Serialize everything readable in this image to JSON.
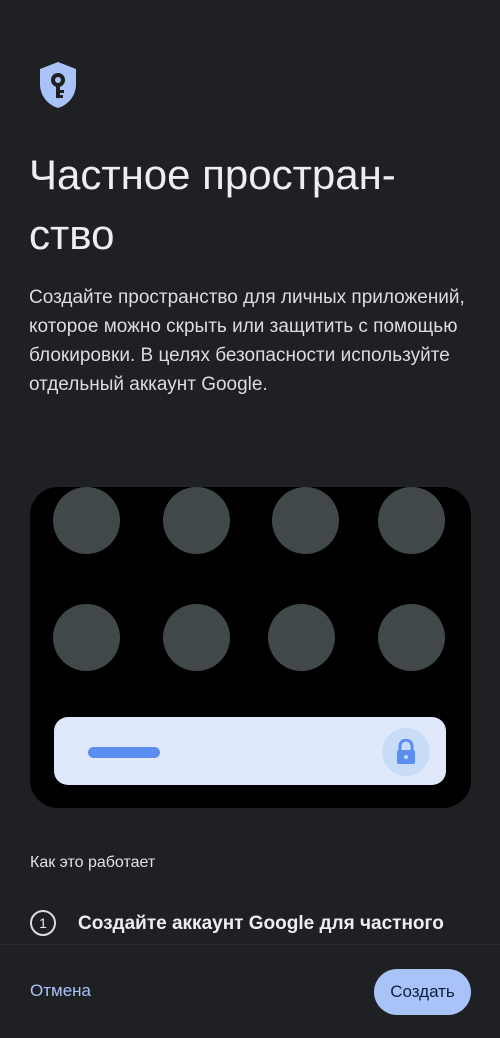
{
  "header": {
    "icon": "shield-key-icon",
    "title": "Частное простран-ство",
    "description": "Создайте пространство для личных приложений, которое можно скрыть или защитить с помощью блокировки. В целях безопасности используйте отдельный аккаунт Google."
  },
  "illustration": {
    "lock_icon": "lock-icon"
  },
  "how_it_works": {
    "heading": "Как это работает",
    "steps": [
      {
        "number": "1",
        "text": "Создайте аккаунт Google для частного пространства"
      }
    ]
  },
  "footer": {
    "cancel_label": "Отмена",
    "create_label": "Создать"
  },
  "colors": {
    "background": "#1f2023",
    "accent": "#a9c3f8",
    "illustration_bg": "#000000",
    "dot": "#41484a",
    "lock_bar": "#dfe9fb",
    "pill": "#5b8ef0"
  }
}
